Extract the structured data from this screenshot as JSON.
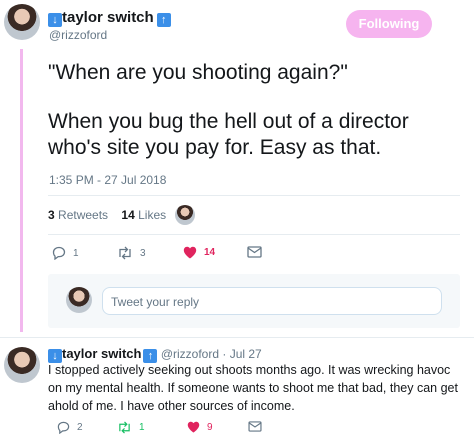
{
  "main_tweet": {
    "display_name": "taylor switch",
    "handle": "@rizzoford",
    "follow_label": "Following",
    "quote": "\"When are you shooting again?\"",
    "body": "When you bug the hell out of a director who's site you pay for. Easy as that.",
    "timestamp": "1:35 PM - 27 Jul 2018",
    "retweets_count": "3",
    "retweets_label": "Retweets",
    "likes_count": "14",
    "likes_label": "Likes",
    "actions": {
      "replies": "1",
      "retweets": "3",
      "likes": "14"
    }
  },
  "reply_composer": {
    "placeholder": "Tweet your reply"
  },
  "reply_tweet": {
    "display_name": "taylor switch",
    "handle": "@rizzoford",
    "date": "Jul 27",
    "body": "I stopped actively seeking out shoots months ago. It was wrecking havoc on my mental health. If someone wants to shoot me that bad, they can get ahold of me. I have other sources of income.",
    "actions": {
      "replies": "2",
      "retweets": "1",
      "likes": "9"
    }
  },
  "colors": {
    "follow_button": "#f6b4ef",
    "heart": "#e0245e",
    "retweet_green": "#17bf63",
    "thread_line": "#f2b8ee",
    "arrow_badge": "#3b8fe8"
  },
  "icons": [
    "down-arrow-badge-icon",
    "up-arrow-badge-icon",
    "reply-icon",
    "retweet-icon",
    "heart-icon",
    "message-icon"
  ]
}
